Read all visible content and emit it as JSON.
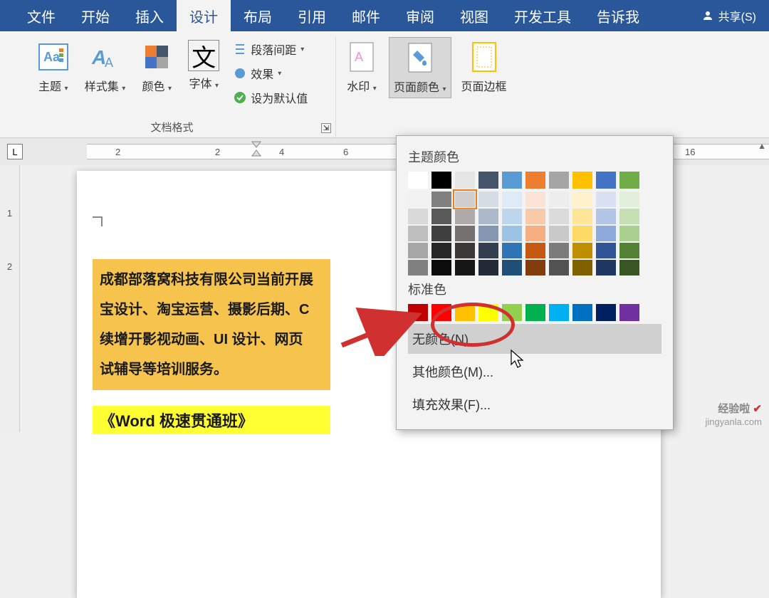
{
  "menu": {
    "file": "文件",
    "home": "开始",
    "insert": "插入",
    "design": "设计",
    "layout": "布局",
    "references": "引用",
    "mailings": "邮件",
    "review": "审阅",
    "view": "视图",
    "developer": "开发工具",
    "tellme": "告诉我",
    "share": "共享(S)"
  },
  "ribbon": {
    "themes": "主题",
    "styleset": "样式集",
    "colors": "颜色",
    "fonts": "字体",
    "paragraph_spacing": "段落间距",
    "effects": "效果",
    "set_default": "设为默认值",
    "watermark": "水印",
    "page_color": "页面颜色",
    "page_borders": "页面边框",
    "group_docformat": "文档格式",
    "icon_text": "文",
    "aa_text": "Aa"
  },
  "ruler": {
    "marks": [
      "2",
      "2",
      "4",
      "6",
      "16"
    ],
    "vmark": "L",
    "vticks": [
      "1",
      "2"
    ]
  },
  "page": {
    "line1": "成都部落窝科技有限公司当前开展",
    "line2": "宝设计、淘宝运营、摄影后期、C",
    "line3": "续增开影视动画、UI 设计、网页",
    "line4": "试辅导等培训服务。",
    "heading": "《Word 极速贯通班》"
  },
  "popup": {
    "theme_colors_label": "主题颜色",
    "standard_colors_label": "标准色",
    "no_color": "无颜色(N)",
    "more_colors": "其他颜色(M)...",
    "fill_effects": "填充效果(F)...",
    "theme_row": [
      "#FFFFFF",
      "#000000",
      "#E7E6E6",
      "#44546A",
      "#5B9BD5",
      "#ED7D31",
      "#A5A5A5",
      "#FFC000",
      "#4472C4",
      "#70AD47"
    ],
    "shade_cols": [
      [
        "#F2F2F2",
        "#D9D9D9",
        "#BFBFBF",
        "#A6A6A6",
        "#808080"
      ],
      [
        "#808080",
        "#595959",
        "#404040",
        "#262626",
        "#0D0D0D"
      ],
      [
        "#D0CECE",
        "#AEAAAA",
        "#767171",
        "#3B3838",
        "#161616"
      ],
      [
        "#D6DCE4",
        "#ACB9CA",
        "#8496B0",
        "#333F4F",
        "#222B35"
      ],
      [
        "#DEEAF6",
        "#BDD6EE",
        "#9CC2E5",
        "#2F75B5",
        "#1F4E78"
      ],
      [
        "#FBE4D5",
        "#F7CAAC",
        "#F4B083",
        "#C65911",
        "#833C0C"
      ],
      [
        "#EDEDED",
        "#DBDBDB",
        "#C9C9C9",
        "#7B7B7B",
        "#525252"
      ],
      [
        "#FFF2CC",
        "#FFE598",
        "#FFD966",
        "#BF8F00",
        "#806000"
      ],
      [
        "#D9E1F2",
        "#B4C6E7",
        "#8EA9DB",
        "#305496",
        "#203764"
      ],
      [
        "#E2EFDA",
        "#C6E0B4",
        "#A9D08E",
        "#548235",
        "#375623"
      ]
    ],
    "standard_row": [
      "#C00000",
      "#FF0000",
      "#FFC000",
      "#FFFF00",
      "#92D050",
      "#00B050",
      "#00B0F0",
      "#0070C0",
      "#002060",
      "#7030A0"
    ]
  },
  "watermark": {
    "brand": "经验啦",
    "url": "jingyanla.com"
  }
}
